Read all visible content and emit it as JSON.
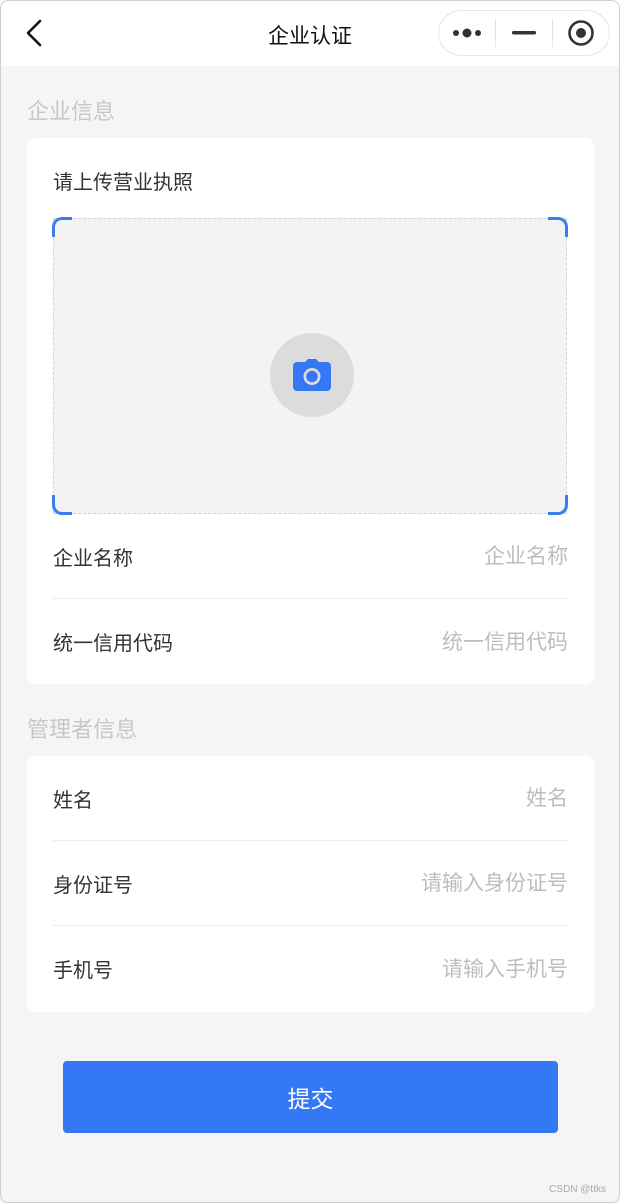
{
  "nav": {
    "title": "企业认证"
  },
  "company_section": {
    "title": "企业信息",
    "upload_label": "请上传营业执照",
    "fields": [
      {
        "label": "企业名称",
        "placeholder": "企业名称",
        "value": ""
      },
      {
        "label": "统一信用代码",
        "placeholder": "统一信用代码",
        "value": ""
      }
    ]
  },
  "manager_section": {
    "title": "管理者信息",
    "fields": [
      {
        "label": "姓名",
        "placeholder": "姓名",
        "value": ""
      },
      {
        "label": "身份证号",
        "placeholder": "请输入身份证号",
        "value": ""
      },
      {
        "label": "手机号",
        "placeholder": "请输入手机号",
        "value": ""
      }
    ]
  },
  "submit_label": "提交",
  "watermark": "CSDN @ttks",
  "icons": {
    "back": "chevron-left-icon",
    "more": "more-dots-icon",
    "minimize": "minus-icon",
    "close": "target-circle-icon",
    "camera": "camera-icon"
  },
  "colors": {
    "accent": "#3478f6",
    "corner": "#3b7de9",
    "background": "#f5f5f5",
    "section_title": "#c7c7c7",
    "placeholder": "#bdbdbd"
  }
}
